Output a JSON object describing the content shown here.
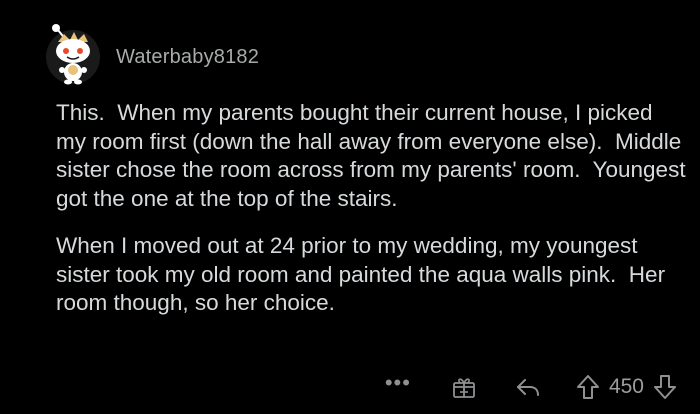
{
  "comment": {
    "author": "Waterbaby8182",
    "paragraphs": [
      "This.  When my parents bought their current house, I picked my room first (down the hall away from everyone else).  Middle sister chose the room across from my parents' room.  Youngest got the one at the top of the stairs.",
      "When I moved out at 24 prior to my wedding, my youngest sister took my old room and painted the aqua walls pink.  Her room though, so her choice."
    ],
    "score": "450",
    "more_label": "•••"
  },
  "icons": {
    "avatar": "snoo-avatar-icon",
    "more": "more-options-icon",
    "award": "award-gift-icon",
    "reply": "reply-arrow-icon",
    "upvote": "upvote-arrow-icon",
    "downvote": "downvote-arrow-icon"
  },
  "colors": {
    "background": "#000000",
    "text": "#d7dadc",
    "username": "#a8aaab",
    "icons": "#8e9092"
  }
}
